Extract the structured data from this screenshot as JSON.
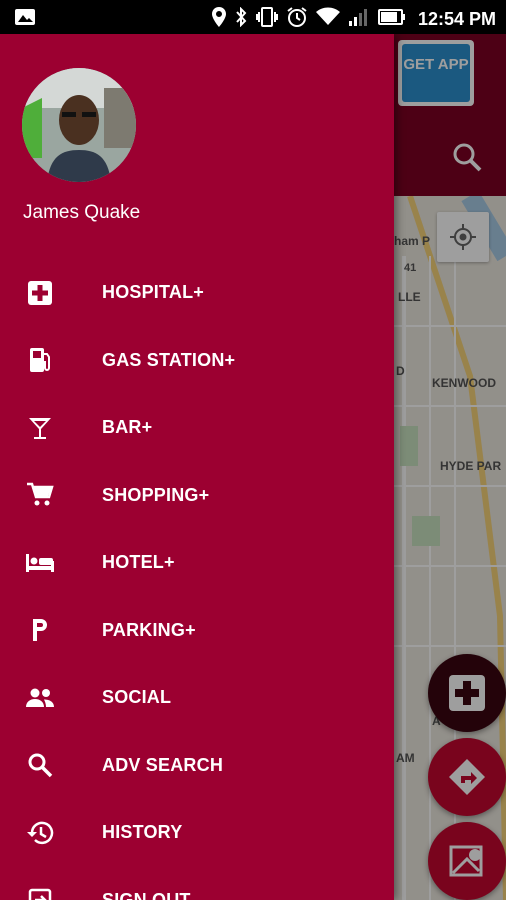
{
  "status_bar": {
    "time": "12:54 PM",
    "icons": [
      "image-notification-icon",
      "location-icon",
      "bluetooth-icon",
      "vibrate-icon",
      "alarm-icon",
      "wifi-icon",
      "signal-icon",
      "battery-icon"
    ]
  },
  "header": {
    "get_app_label": "GET APP",
    "search_icon": "search-icon"
  },
  "map": {
    "labels": {
      "hyde_park_partial": "ham P",
      "route": "41",
      "ville_partial": "LLE",
      "d_partial": "D",
      "kenwood": "KENWOOD",
      "hyde_park": "HYDE PAR",
      "am_partial": "AM",
      "a_partial": "A"
    }
  },
  "drawer": {
    "user_name": "James Quake",
    "menu": [
      {
        "label": "HOSPITAL+",
        "icon": "hospital-icon"
      },
      {
        "label": "GAS STATION+",
        "icon": "gas-station-icon"
      },
      {
        "label": "BAR+",
        "icon": "cocktail-icon"
      },
      {
        "label": "SHOPPING+",
        "icon": "cart-icon"
      },
      {
        "label": "HOTEL+",
        "icon": "hotel-bed-icon"
      },
      {
        "label": "PARKING+",
        "icon": "parking-icon"
      },
      {
        "label": "SOCIAL",
        "icon": "people-icon"
      },
      {
        "label": "ADV SEARCH",
        "icon": "search-icon"
      },
      {
        "label": "HISTORY",
        "icon": "history-icon"
      },
      {
        "label": "SIGN OUT",
        "icon": "sign-out-icon"
      }
    ]
  },
  "colors": {
    "drawer_bg": "#9c0031",
    "header_bg": "#7d0023",
    "fab_red": "#c40730",
    "get_app_blue": "#2d90cf"
  }
}
